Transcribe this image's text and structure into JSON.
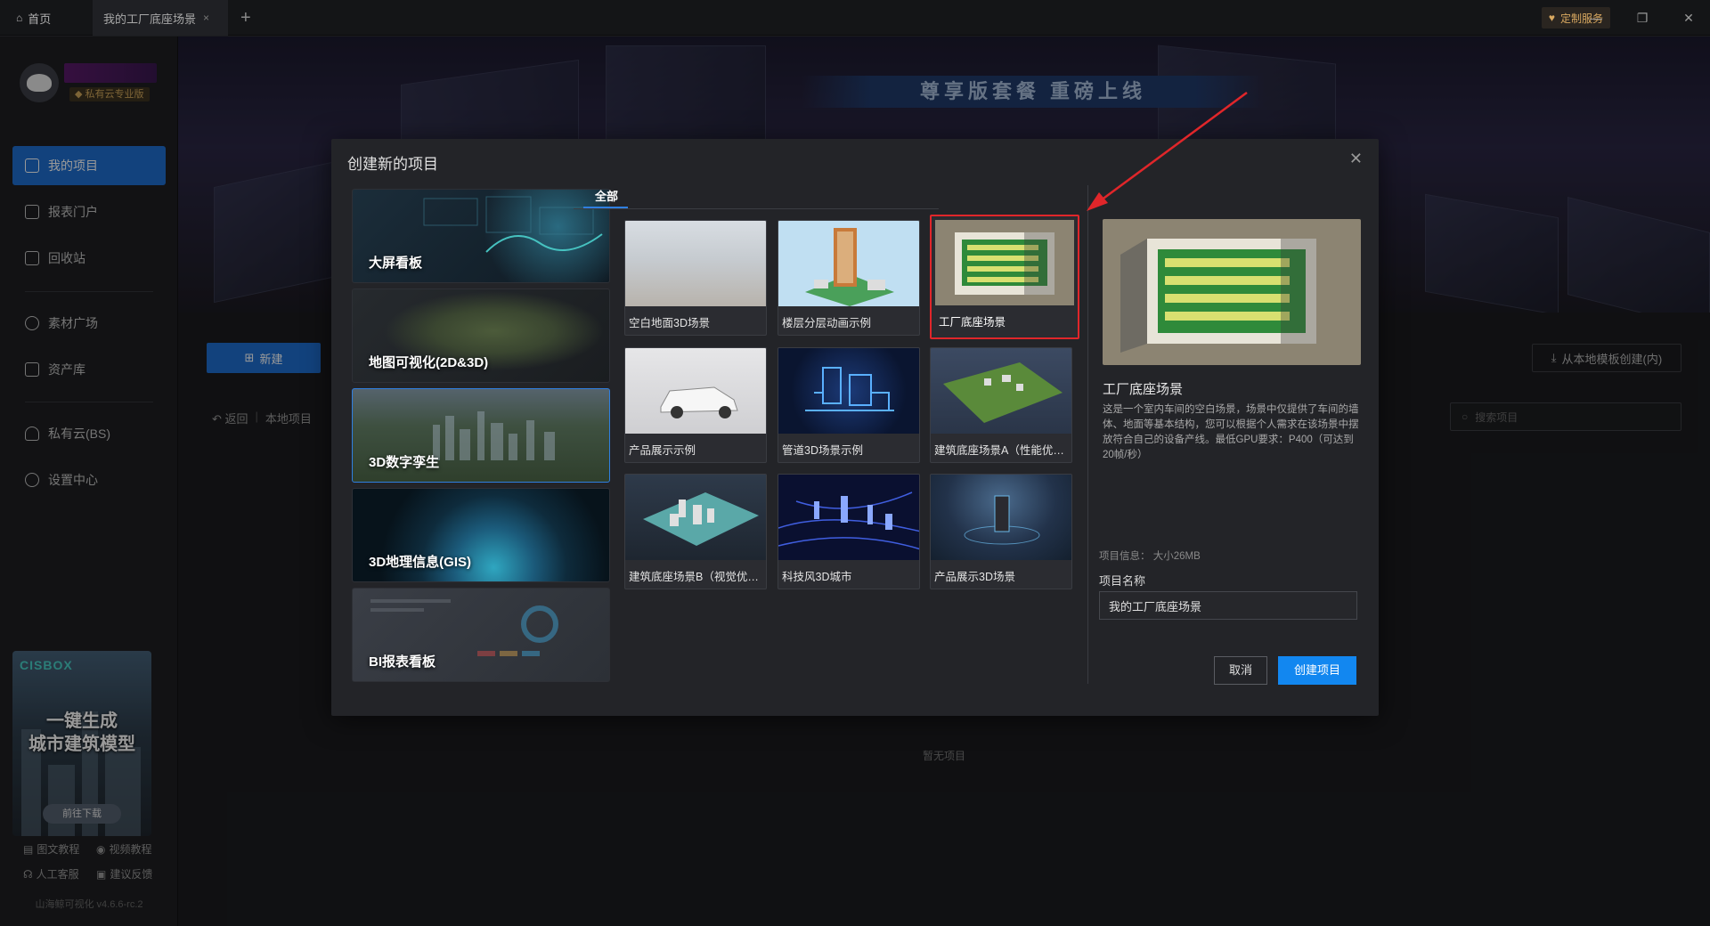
{
  "titlebar": {
    "home_tab": "首页",
    "active_tab": "我的工厂底座场景",
    "add_tab_icon": "plus-icon",
    "custom_service": "定制服务"
  },
  "sidebar": {
    "badge": "私有云专业版",
    "items": [
      {
        "label": "我的项目",
        "icon": "project-icon",
        "active": true
      },
      {
        "label": "报表门户",
        "icon": "report-icon"
      },
      {
        "label": "回收站",
        "icon": "trash-icon"
      },
      {
        "label": "素材广场",
        "icon": "material-icon"
      },
      {
        "label": "资产库",
        "icon": "asset-icon"
      },
      {
        "label": "私有云(BS)",
        "icon": "cloud-icon"
      },
      {
        "label": "设置中心",
        "icon": "gear-icon"
      }
    ],
    "promo": {
      "logo": "CISBOX",
      "line1": "一键生成",
      "line2": "城市建筑模型",
      "button": "前往下载"
    },
    "help": {
      "docs": "图文教程",
      "video": "视频教程",
      "support": "人工客服",
      "feedback": "建议反馈"
    },
    "version": "山海鲸可视化 v4.6.6-rc.2"
  },
  "main": {
    "banner_title": "尊享版套餐 重磅上线",
    "new_button": "新建",
    "back": "返回",
    "breadcrumb": "本地项目",
    "local_template_button": "从本地模板创建(内)",
    "search_placeholder": "搜索项目",
    "empty": "暂无项目"
  },
  "modal": {
    "title": "创建新的项目",
    "categories": [
      {
        "label": "大屏看板"
      },
      {
        "label": "地图可视化(2D&3D)"
      },
      {
        "label": "3D数字孪生",
        "selected": true
      },
      {
        "label": "3D地理信息(GIS)"
      },
      {
        "label": "BI报表看板"
      }
    ],
    "tab_all": "全部",
    "templates": [
      {
        "label": "空白地面3D场景"
      },
      {
        "label": "楼层分层动画示例"
      },
      {
        "label": "工厂底座场景",
        "selected": true
      },
      {
        "label": "产品展示示例"
      },
      {
        "label": "管道3D场景示例"
      },
      {
        "label": "建筑底座场景A（性能优…"
      },
      {
        "label": "建筑底座场景B（视觉优…"
      },
      {
        "label": "科技风3D城市"
      },
      {
        "label": "产品展示3D场景"
      }
    ],
    "detail": {
      "title": "工厂底座场景",
      "description": "这是一个室内车间的空白场景，场景中仅提供了车间的墙体、地面等基本结构，您可以根据个人需求在该场景中摆放符合自己的设备产线。最低GPU要求：P400（可达到20帧/秒）",
      "info": "项目信息： 大小26MB",
      "name_label": "项目名称",
      "name_value": "我的工厂底座场景"
    },
    "cancel": "取消",
    "create": "创建项目"
  },
  "colors": {
    "accent": "#1f6fd1",
    "create_button": "#1287f0",
    "highlight": "#e0262a"
  }
}
